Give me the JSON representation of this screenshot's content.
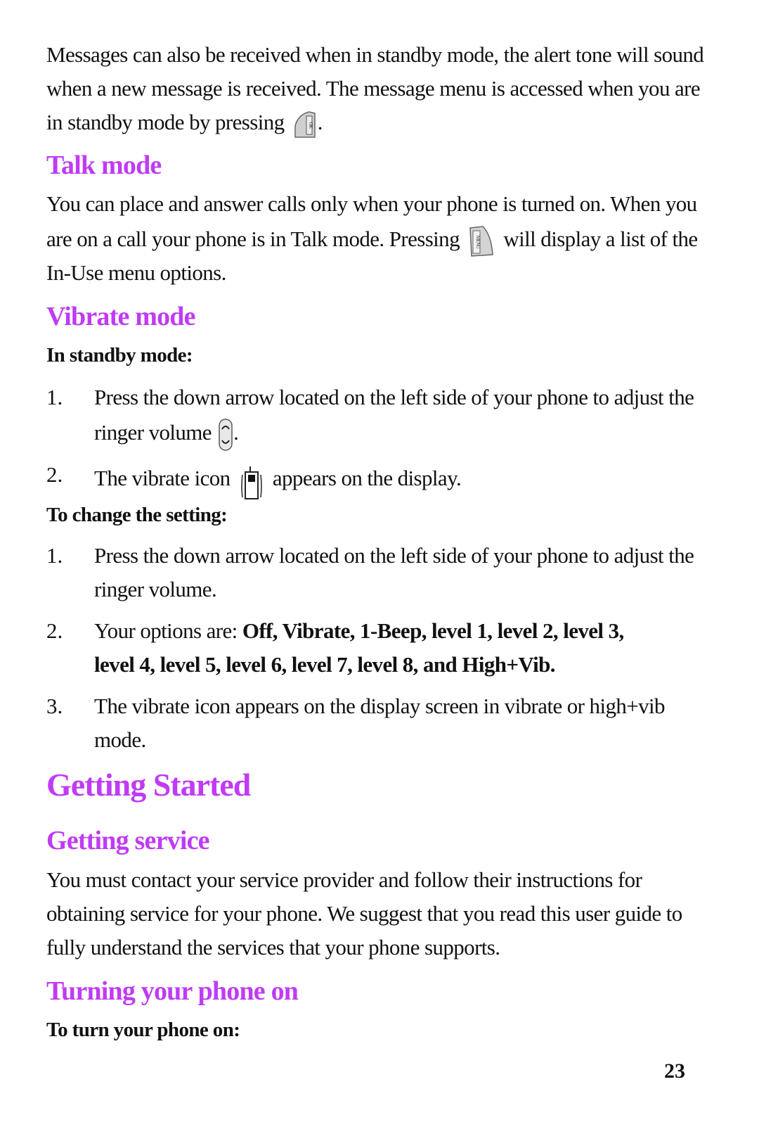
{
  "intro": {
    "line1": "Messages can also be received when in standby mode, the alert tone will sound",
    "line2": "when a new message is received. The message menu is accessed when you are",
    "line3_before": "in standby mode by pressing",
    "line3_after": ".",
    "ok_key_icon": "ok-key-icon"
  },
  "talk_mode": {
    "heading": "Talk mode",
    "line1": "You can place and answer calls only when your phone is turned on. When you",
    "line2_before": "are on a call your phone is in Talk mode. Pressing",
    "line2_after": "will display a list of the",
    "line3": "In-Use menu options.",
    "menu_key_icon": "menu-key-icon"
  },
  "vibrate_mode": {
    "heading": "Vibrate mode",
    "standby_label": "In standby mode:",
    "standby_steps": [
      {
        "num": "1.",
        "line1": "Press the down arrow located on the left side of your phone to adjust the",
        "line2_before": "ringer volume",
        "line2_after": "."
      },
      {
        "num": "2.",
        "before": "The vibrate icon",
        "after": "appears on the display."
      }
    ],
    "change_label": "To change the setting:",
    "change_steps": [
      {
        "num": "1.",
        "line1": "Press the down arrow located on the left side of your phone to adjust the",
        "line2": "ringer volume."
      },
      {
        "num": "2.",
        "line1_prefix": "Your options are: ",
        "line1_bold": "Off, Vibrate, 1-Beep, level 1, level 2, level 3,",
        "line2_bold": "level 4, level 5, level 6, level 7, level 8, and High+Vib."
      },
      {
        "num": "3.",
        "line1": "The vibrate icon appears on the display screen in vibrate or high+vib",
        "line2": "mode."
      }
    ]
  },
  "getting_started": {
    "heading": "Getting Started"
  },
  "getting_service": {
    "heading": "Getting service",
    "line1": "You must contact your service provider and follow their instructions for",
    "line2": "obtaining service for your phone. We suggest that you read this user guide to",
    "line3": "fully understand the services that your phone supports."
  },
  "turning_on": {
    "heading": "Turning your phone on",
    "sub": "To turn your phone on:"
  },
  "page_number": "23",
  "colors": {
    "heading": "#c03bf5",
    "text": "#111111"
  }
}
